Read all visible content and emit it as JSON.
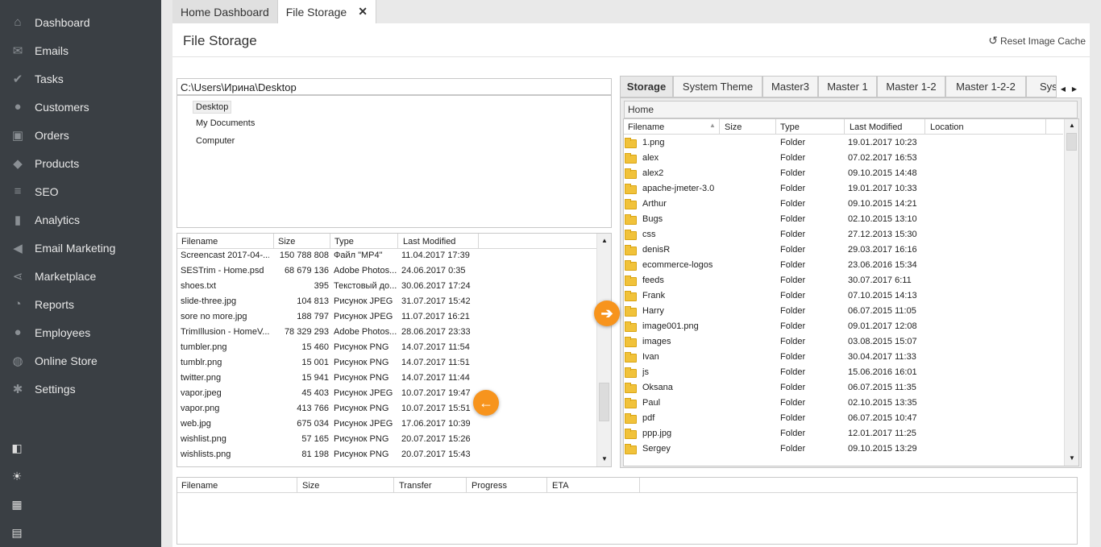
{
  "sidebar": {
    "items": [
      {
        "label": "Dashboard",
        "icon": "home-icon",
        "glyph": "⌂"
      },
      {
        "label": "Emails",
        "icon": "mail-icon",
        "glyph": "✉"
      },
      {
        "label": "Tasks",
        "icon": "tasks-icon",
        "glyph": "✔"
      },
      {
        "label": "Customers",
        "icon": "user-icon",
        "glyph": "●"
      },
      {
        "label": "Orders",
        "icon": "cart-icon",
        "glyph": "▣"
      },
      {
        "label": "Products",
        "icon": "tag-icon",
        "glyph": "◆"
      },
      {
        "label": "SEO",
        "icon": "sliders-icon",
        "glyph": "≡"
      },
      {
        "label": "Analytics",
        "icon": "bar-chart-icon",
        "glyph": "▮"
      },
      {
        "label": "Email Marketing",
        "icon": "megaphone-icon",
        "glyph": "◀"
      },
      {
        "label": "Marketplace",
        "icon": "share-icon",
        "glyph": "⋖"
      },
      {
        "label": "Reports",
        "icon": "pie-chart-icon",
        "glyph": "◔"
      },
      {
        "label": "Employees",
        "icon": "users-icon",
        "glyph": "●"
      },
      {
        "label": "Online Store",
        "icon": "globe-icon",
        "glyph": "◍"
      },
      {
        "label": "Settings",
        "icon": "gear-icon",
        "glyph": "✱"
      }
    ],
    "bottom_icons": [
      "layout-icon",
      "lightbulb-icon",
      "calculator-icon",
      "calendar-icon"
    ]
  },
  "tabs": [
    {
      "label": "Home Dashboard",
      "active": false
    },
    {
      "label": "File Storage",
      "active": true,
      "close": "✕"
    }
  ],
  "page": {
    "title": "File Storage",
    "reset_label": "Reset Image Cache"
  },
  "local": {
    "path": "C:\\Users\\Ирина\\Desktop",
    "tree": [
      "Desktop",
      "My Documents",
      "Computer"
    ],
    "columns": [
      "Filename",
      "Size",
      "Type",
      "Last Modified"
    ],
    "files": [
      [
        "Screencast 2017-04-...",
        "150 788 808",
        "Файл \"MP4\"",
        "11.04.2017 17:39"
      ],
      [
        "SESTrim - Home.psd",
        "68 679 136",
        "Adobe Photos...",
        "24.06.2017 0:35"
      ],
      [
        "shoes.txt",
        "395",
        "Текстовый до...",
        "30.06.2017 17:24"
      ],
      [
        "slide-three.jpg",
        "104 813",
        "Рисунок JPEG",
        "31.07.2017 15:42"
      ],
      [
        "sore no more.jpg",
        "188 797",
        "Рисунок JPEG",
        "11.07.2017 16:21"
      ],
      [
        "TrimIllusion - HomeV...",
        "78 329 293",
        "Adobe Photos...",
        "28.06.2017 23:33"
      ],
      [
        "tumbler.png",
        "15 460",
        "Рисунок PNG",
        "14.07.2017 11:54"
      ],
      [
        "tumblr.png",
        "15 001",
        "Рисунок PNG",
        "14.07.2017 11:51"
      ],
      [
        "twitter.png",
        "15 941",
        "Рисунок PNG",
        "14.07.2017 11:44"
      ],
      [
        "vapor.jpeg",
        "45 403",
        "Рисунок JPEG",
        "10.07.2017 19:47"
      ],
      [
        "vapor.png",
        "413 766",
        "Рисунок PNG",
        "10.07.2017 15:51"
      ],
      [
        "web.jpg",
        "675 034",
        "Рисунок JPEG",
        "17.06.2017 10:39"
      ],
      [
        "wishlist.png",
        "57 165",
        "Рисунок PNG",
        "20.07.2017 15:26"
      ],
      [
        "wishlists.png",
        "81 198",
        "Рисунок PNG",
        "20.07.2017 15:43"
      ]
    ]
  },
  "remote": {
    "tabs": [
      "Storage",
      "System Theme",
      "Master3",
      "Master 1",
      "Master 1-2",
      "Master 1-2-2",
      "Sys"
    ],
    "breadcrumb": "Home",
    "columns": [
      "Filename",
      "Size",
      "Type",
      "Last Modified",
      "Location"
    ],
    "folders": [
      [
        "1.png",
        "Folder",
        "19.01.2017 10:23"
      ],
      [
        "alex",
        "Folder",
        "07.02.2017 16:53"
      ],
      [
        "alex2",
        "Folder",
        "09.10.2015 14:48"
      ],
      [
        "apache-jmeter-3.0",
        "Folder",
        "19.01.2017 10:33"
      ],
      [
        "Arthur",
        "Folder",
        "09.10.2015 14:21"
      ],
      [
        "Bugs",
        "Folder",
        "02.10.2015 13:10"
      ],
      [
        "css",
        "Folder",
        "27.12.2013 15:30"
      ],
      [
        "denisR",
        "Folder",
        "29.03.2017 16:16"
      ],
      [
        "ecommerce-logos",
        "Folder",
        "23.06.2016 15:34"
      ],
      [
        "feeds",
        "Folder",
        "30.07.2017 6:11"
      ],
      [
        "Frank",
        "Folder",
        "07.10.2015 14:13"
      ],
      [
        "Harry",
        "Folder",
        "06.07.2015 11:05"
      ],
      [
        "image001.png",
        "Folder",
        "09.01.2017 12:08"
      ],
      [
        "images",
        "Folder",
        "03.08.2015 15:07"
      ],
      [
        "Ivan",
        "Folder",
        "30.04.2017 11:33"
      ],
      [
        "js",
        "Folder",
        "15.06.2016 16:01"
      ],
      [
        "Oksana",
        "Folder",
        "06.07.2015 11:35"
      ],
      [
        "Paul",
        "Folder",
        "02.10.2015 13:35"
      ],
      [
        "pdf",
        "Folder",
        "06.07.2015 10:47"
      ],
      [
        "ppp.jpg",
        "Folder",
        "12.01.2017 11:25"
      ],
      [
        "Sergey",
        "Folder",
        "09.10.2015 13:29"
      ]
    ]
  },
  "transfer": {
    "columns": [
      "Filename",
      "Size",
      "Transfer",
      "Progress",
      "ETA"
    ]
  },
  "buttons": {
    "upload_glyph": "➔",
    "download_glyph": "←"
  },
  "colors": {
    "sidebar": "#3a3f44",
    "accent": "#f7941d"
  }
}
